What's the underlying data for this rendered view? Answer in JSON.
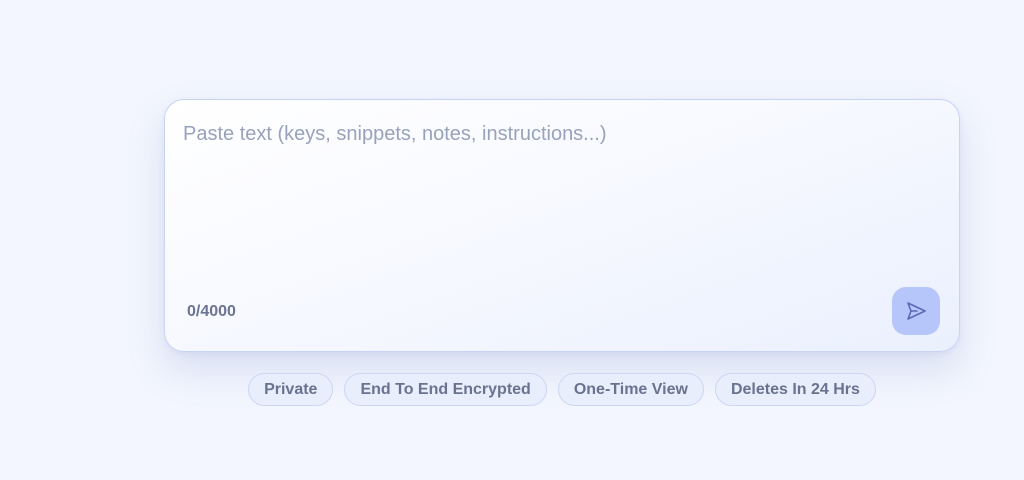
{
  "composer": {
    "placeholder": "Paste text (keys, snippets, notes, instructions...)",
    "value": "",
    "char_count": "0/4000",
    "send_icon": "send-icon"
  },
  "tags": [
    {
      "label": "Private"
    },
    {
      "label": "End To End Encrypted"
    },
    {
      "label": "One-Time View"
    },
    {
      "label": "Deletes In 24 Hrs"
    }
  ],
  "colors": {
    "background": "#f3f6fe",
    "send_button": "#b6c6fb",
    "tag_background": "#e9eefc",
    "tag_text": "#69738f",
    "placeholder": "#98a2bb"
  }
}
